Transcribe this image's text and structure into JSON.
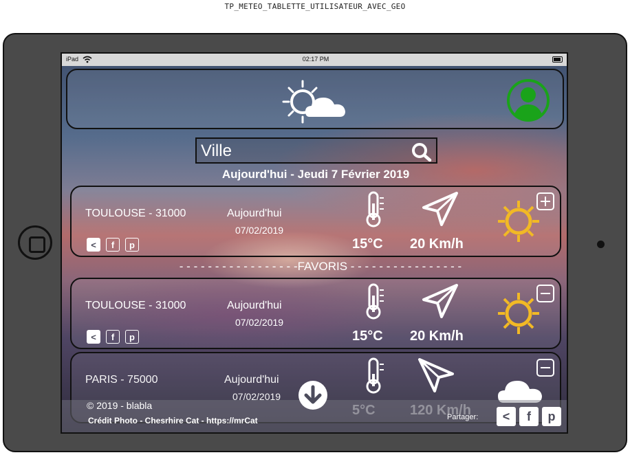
{
  "page_caption": "TP_METEO_TABLETTE_UTILISATEUR_AVEC_GEO",
  "statusbar": {
    "carrier": "iPad",
    "time": "02:17 PM"
  },
  "search": {
    "placeholder": "Ville"
  },
  "date_line": "Aujourd'hui - Jeudi 7 Février 2019",
  "favoris_label": "-FAVORIS",
  "cards": [
    {
      "city": "TOULOUSE - 31000",
      "today": "Aujourd'hui",
      "date": "07/02/2019",
      "temp": "15°C",
      "wind": "20 Km/h",
      "weather": "sun-icon",
      "action": "add"
    },
    {
      "city": "TOULOUSE - 31000",
      "today": "Aujourd'hui",
      "date": "07/02/2019",
      "temp": "15°C",
      "wind": "20 Km/h",
      "weather": "sun-icon",
      "action": "remove"
    },
    {
      "city": "PARIS - 75000",
      "today": "Aujourd'hui",
      "date": "07/02/2019",
      "temp": "5°C",
      "wind": "120 Km/h",
      "weather": "cloud-icon",
      "action": "remove"
    }
  ],
  "social_icons": [
    "share-icon",
    "facebook-icon",
    "pinterest-icon"
  ],
  "footer": {
    "copyright": "2019 - blabla",
    "credit": "Crédit Photo - Chesrhire Cat - https://mrCat",
    "share_label": "Partager:"
  },
  "colors": {
    "avatar": "#1aa31a",
    "sun": "#f2b925",
    "tablet": "#4a4a4a"
  }
}
